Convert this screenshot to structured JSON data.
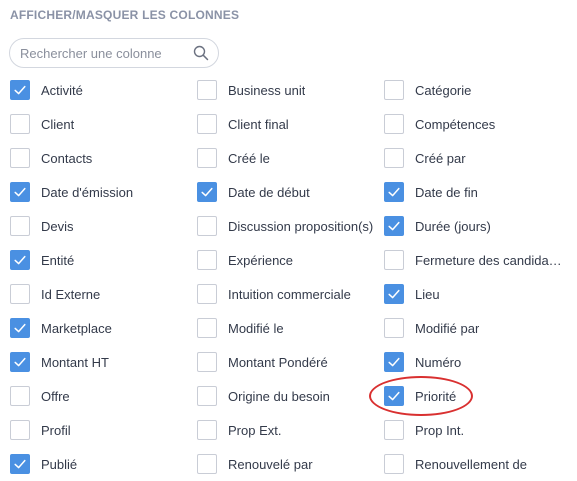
{
  "panel": {
    "title": "AFFICHER/MASQUER LES COLONNES"
  },
  "search": {
    "placeholder": "Rechercher une colonne",
    "value": "",
    "icon": "search-icon"
  },
  "colors": {
    "checked": "#4a90e2",
    "highlight": "#d93030",
    "title": "#8a92a6"
  },
  "options": [
    {
      "label": "Activité",
      "checked": true
    },
    {
      "label": "Business unit",
      "checked": false
    },
    {
      "label": "Catégorie",
      "checked": false
    },
    {
      "label": "Client",
      "checked": false
    },
    {
      "label": "Client final",
      "checked": false
    },
    {
      "label": "Compétences",
      "checked": false
    },
    {
      "label": "Contacts",
      "checked": false
    },
    {
      "label": "Créé le",
      "checked": false
    },
    {
      "label": "Créé par",
      "checked": false
    },
    {
      "label": "Date d'émission",
      "checked": true
    },
    {
      "label": "Date de début",
      "checked": true
    },
    {
      "label": "Date de fin",
      "checked": true
    },
    {
      "label": "Devis",
      "checked": false
    },
    {
      "label": "Discussion proposition(s)",
      "checked": false
    },
    {
      "label": "Durée (jours)",
      "checked": true
    },
    {
      "label": "Entité",
      "checked": true
    },
    {
      "label": "Expérience",
      "checked": false
    },
    {
      "label": "Fermeture des candida…",
      "checked": false
    },
    {
      "label": "Id Externe",
      "checked": false
    },
    {
      "label": "Intuition commerciale",
      "checked": false
    },
    {
      "label": "Lieu",
      "checked": true
    },
    {
      "label": "Marketplace",
      "checked": true
    },
    {
      "label": "Modifié le",
      "checked": false
    },
    {
      "label": "Modifié par",
      "checked": false
    },
    {
      "label": "Montant HT",
      "checked": true
    },
    {
      "label": "Montant Pondéré",
      "checked": false
    },
    {
      "label": "Numéro",
      "checked": true
    },
    {
      "label": "Offre",
      "checked": false
    },
    {
      "label": "Origine du besoin",
      "checked": false
    },
    {
      "label": "Priorité",
      "checked": true
    },
    {
      "label": "Profil",
      "checked": false
    },
    {
      "label": "Prop Ext.",
      "checked": false
    },
    {
      "label": "Prop Int.",
      "checked": false
    },
    {
      "label": "Publié",
      "checked": true
    },
    {
      "label": "Renouvelé par",
      "checked": false
    },
    {
      "label": "Renouvellement de",
      "checked": false
    }
  ]
}
